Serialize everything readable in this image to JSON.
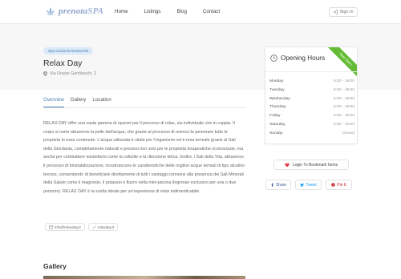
{
  "header": {
    "brand_main": "prenota",
    "brand_accent": "SPA",
    "nav": [
      "Home",
      "Listings",
      "Blog",
      "Contact"
    ],
    "sign_in": "Sign In"
  },
  "listing": {
    "category_tag": "Spa Guidonia Montecelio",
    "title": "Relax Day",
    "address": "Via Orazio Gentileschi, 2"
  },
  "tabs": [
    "Overview",
    "Gallery",
    "Location"
  ],
  "description": "RELAX DAY offre una vasta gamma di opzioni per il percorso di relax, sia individuale che in coppia. Il corpo si nutre attraverso la pelle dell'acqua, che grazie al processo di osmosi fa penetrare tutte le proprietà in essa contenute. L'acqua utilizzata è vitale per l'organismo ed è resa termale grazie ai Sali della Giordania, completamente naturali e preziosi non solo per le proprietà terapeutiche riconosciute, ma anche per combattere inestetismi come la cellulite e la ritenzione idrica. Inoltre, i Sali della Vita, attraverso il processo di biostabilizzazione, ricostruiscono le caratteristiche delle migliori acque termali di tipo alcalino terroso, consentendo di beneficiare direttamente di tutti i vantaggi connessi alla presenza dei Sali Minerali della Salute come il magnesio, il potassio e fluoro nella mini-piscina lingresso esclusivo per una o due persone). RELAX DAY è la scelta ideale per un'esperienza di relax indimenticabile.",
  "contacts": {
    "email": "info@relaxday.it",
    "website": "relaxday.it"
  },
  "gallery_title": "Gallery",
  "opening_hours": {
    "title": "Opening Hours",
    "badge": "Now Open",
    "rows": [
      {
        "day": "Monday",
        "time": "9:00 - 19:00"
      },
      {
        "day": "Tuesday",
        "time": "9:00 - 19:00"
      },
      {
        "day": "Wednesday",
        "time": "9:00 - 19:00"
      },
      {
        "day": "Thursday",
        "time": "9:00 - 19:00"
      },
      {
        "day": "Friday",
        "time": "9:00 - 19:00"
      },
      {
        "day": "Saturday",
        "time": "9:00 - 19:00"
      },
      {
        "day": "Sunday",
        "time": "Closed"
      }
    ]
  },
  "actions": {
    "bookmark": "Login To Bookmark Items",
    "share": "Share",
    "tweet": "Tweet",
    "pin": "Pin It"
  },
  "colors": {
    "accent_blue": "#4a7bb7",
    "open_badge": "#64bc36",
    "bookmark_heart": "#e4344b"
  }
}
